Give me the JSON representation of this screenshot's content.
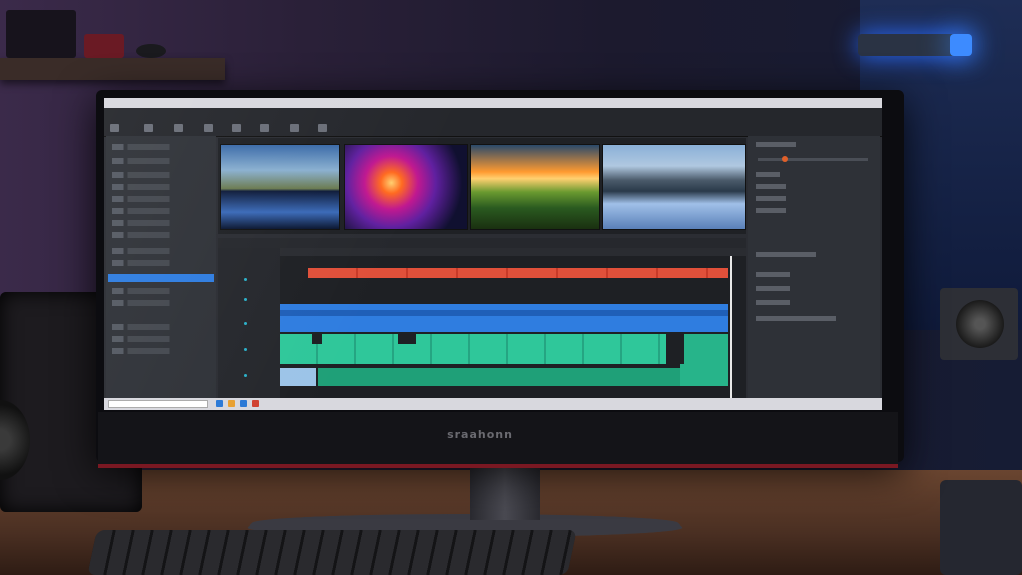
{
  "scene": {
    "description_type": "photo of ultrawide curved monitor showing video editing software",
    "monitor_brand": "sraahonn",
    "colors": {
      "timeline_red": "#e0503a",
      "timeline_blue": "#2f7de0",
      "timeline_green": "#2fc79a",
      "selection_blue": "#2f7de0",
      "lamp_blue": "#3d8bff",
      "bezel_red_trim": "#7a1822"
    }
  },
  "editor": {
    "icons": [
      "media-thumbnail-icon",
      "timeline-clip-icon",
      "playhead-icon"
    ]
  }
}
